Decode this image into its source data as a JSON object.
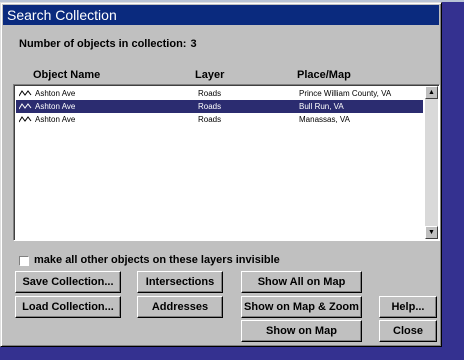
{
  "window": {
    "title": "Search Collection"
  },
  "count": {
    "label": "Number of objects in collection:",
    "value": "3"
  },
  "columns": {
    "object_name": "Object Name",
    "layer": "Layer",
    "place_map": "Place/Map"
  },
  "rows": [
    {
      "name": "Ashton Ave",
      "layer": "Roads",
      "place": "Prince William County, VA",
      "selected": false
    },
    {
      "name": "Ashton Ave",
      "layer": "Roads",
      "place": "Bull Run, VA",
      "selected": true
    },
    {
      "name": "Ashton Ave",
      "layer": "Roads",
      "place": "Manassas, VA",
      "selected": false
    }
  ],
  "icons": {
    "row_icon": "road-line-icon",
    "scroll_up": "arrow-up-icon",
    "scroll_down": "arrow-down-icon"
  },
  "checkbox": {
    "label": "make all other objects on these layers invisible",
    "checked": false
  },
  "buttons": {
    "save_collection": "Save Collection...",
    "load_collection": "Load Collection...",
    "intersections": "Intersections",
    "addresses": "Addresses",
    "show_all_on_map": "Show All on Map",
    "show_on_map_zoom": "Show on Map & Zoom",
    "show_on_map": "Show on Map",
    "help": "Help...",
    "close": "Close"
  },
  "colors": {
    "desktop": "#343190",
    "titlebar": "#0a2a7e",
    "selection": "#2b2c70",
    "window": "#c0c0c0"
  }
}
